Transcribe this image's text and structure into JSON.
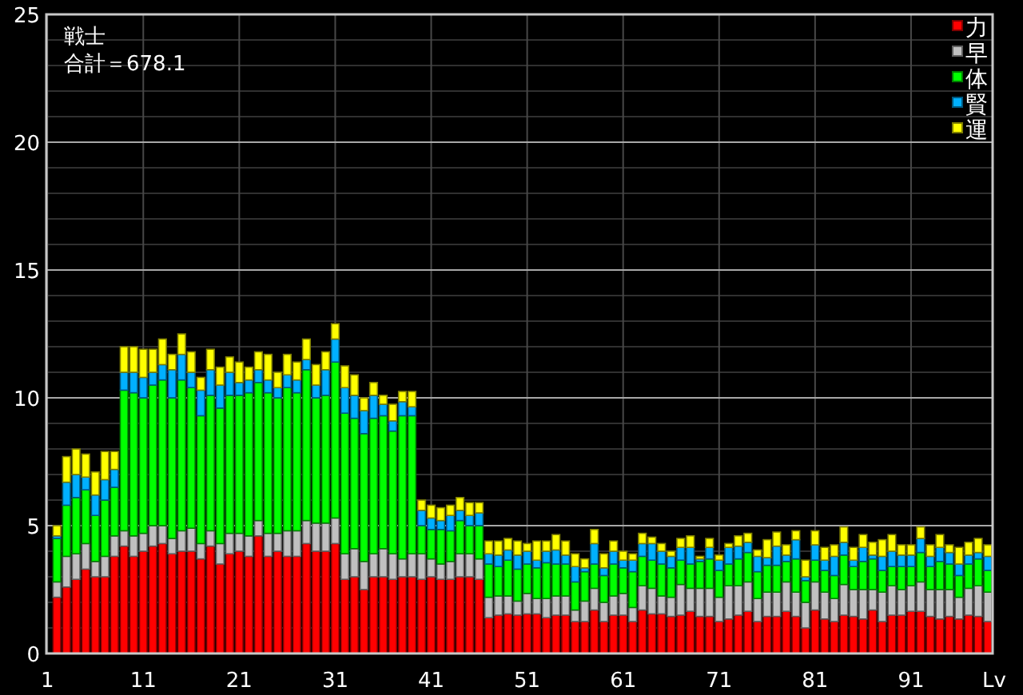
{
  "chart": {
    "total_label": "合計＝678.1",
    "chart_data": {
      "type": "bar",
      "stacked": true,
      "title": "戦士",
      "xlabel": "Lv",
      "x": [
        2,
        3,
        4,
        5,
        6,
        7,
        8,
        9,
        10,
        11,
        12,
        13,
        14,
        15,
        16,
        17,
        18,
        19,
        20,
        21,
        22,
        23,
        24,
        25,
        26,
        27,
        28,
        29,
        30,
        31,
        32,
        33,
        34,
        35,
        36,
        37,
        38,
        39,
        40,
        41,
        42,
        43,
        44,
        45,
        46,
        47,
        48,
        49,
        50,
        51,
        52,
        53,
        54,
        55,
        56,
        57,
        58,
        59,
        60,
        61,
        62,
        63,
        64,
        65,
        66,
        67,
        68,
        69,
        70,
        71,
        72,
        73,
        74,
        75,
        76,
        77,
        78,
        79,
        80,
        81,
        82,
        83,
        84,
        85,
        86,
        87,
        88,
        89,
        90,
        91,
        92,
        93,
        94,
        95,
        96,
        97,
        98,
        99
      ],
      "xlim": [
        0.9,
        99.5
      ],
      "ylim": [
        0,
        25
      ],
      "xticks": [
        1,
        11,
        21,
        31,
        41,
        51,
        61,
        71,
        81,
        91
      ],
      "yticks": [
        0,
        5,
        10,
        15,
        20,
        25
      ],
      "grid": true,
      "legend": true,
      "series": [
        {
          "name": "力",
          "color": "#ff0000",
          "values": [
            2.2,
            2.6,
            2.9,
            3.3,
            3.0,
            3.0,
            3.8,
            4.2,
            3.8,
            4.0,
            4.2,
            4.3,
            3.9,
            4.0,
            4.0,
            3.7,
            4.2,
            3.5,
            3.9,
            4.0,
            3.8,
            4.6,
            3.8,
            4.0,
            3.8,
            3.8,
            4.3,
            4.0,
            4.0,
            4.3,
            2.9,
            3.0,
            2.5,
            3.0,
            3.0,
            2.9,
            3.0,
            3.0,
            2.9,
            3.0,
            2.9,
            2.9,
            3.0,
            3.0,
            2.9,
            1.4,
            1.5,
            1.55,
            1.5,
            1.55,
            1.55,
            1.4,
            1.5,
            1.5,
            1.25,
            1.25,
            1.7,
            1.25,
            1.5,
            1.5,
            1.25,
            1.7,
            1.55,
            1.55,
            1.45,
            1.5,
            1.65,
            1.45,
            1.45,
            1.25,
            1.35,
            1.5,
            1.65,
            1.25,
            1.45,
            1.45,
            1.65,
            1.45,
            1.0,
            1.7,
            1.35,
            1.25,
            1.5,
            1.45,
            1.35,
            1.7,
            1.25,
            1.5,
            1.5,
            1.65,
            1.65,
            1.45,
            1.35,
            1.45,
            1.35,
            1.5,
            1.45,
            1.25
          ]
        },
        {
          "name": "早",
          "color": "#c0c0c0",
          "values": [
            0.6,
            1.2,
            1.0,
            1.0,
            0.6,
            0.8,
            0.8,
            0.6,
            0.8,
            0.7,
            0.8,
            0.7,
            0.6,
            0.8,
            0.9,
            0.6,
            0.6,
            0.8,
            0.8,
            0.7,
            0.8,
            0.6,
            0.9,
            0.7,
            1.0,
            1.0,
            0.9,
            1.1,
            1.1,
            1.0,
            1.0,
            1.1,
            1.1,
            0.9,
            1.1,
            1.0,
            0.7,
            0.9,
            1.0,
            0.7,
            0.6,
            0.7,
            0.9,
            0.9,
            0.8,
            0.8,
            0.75,
            0.7,
            0.55,
            0.8,
            0.6,
            0.75,
            0.75,
            0.75,
            0.45,
            0.8,
            0.85,
            0.75,
            0.75,
            0.85,
            0.55,
            0.95,
            1.0,
            0.7,
            0.75,
            1.2,
            0.9,
            1.1,
            1.1,
            0.95,
            1.3,
            1.15,
            1.15,
            0.9,
            0.95,
            0.95,
            1.15,
            0.95,
            1.0,
            1.1,
            1.05,
            0.9,
            1.2,
            1.05,
            1.15,
            0.8,
            1.15,
            1.15,
            1.0,
            1.0,
            1.15,
            1.05,
            1.15,
            1.05,
            0.85,
            1.05,
            1.2,
            1.15
          ]
        },
        {
          "name": "体",
          "color": "#00ff00",
          "values": [
            1.7,
            2.0,
            2.2,
            2.1,
            1.8,
            2.2,
            1.9,
            5.5,
            5.6,
            5.3,
            5.5,
            5.7,
            5.5,
            5.9,
            5.5,
            5.0,
            5.3,
            5.3,
            5.4,
            5.4,
            5.6,
            5.4,
            5.5,
            5.3,
            5.6,
            5.4,
            5.9,
            4.9,
            5.0,
            6.1,
            5.5,
            5.1,
            5.0,
            5.3,
            5.2,
            4.8,
            5.6,
            5.4,
            1.1,
            1.15,
            1.35,
            1.2,
            1.3,
            1.1,
            1.3,
            1.3,
            1.15,
            1.4,
            1.25,
            1.15,
            1.2,
            1.4,
            1.25,
            1.25,
            1.1,
            1.15,
            0.95,
            1.05,
            1.25,
            1.0,
            1.4,
            1.15,
            1.1,
            1.25,
            1.15,
            0.95,
            0.95,
            1.05,
            1.15,
            1.05,
            0.85,
            1.05,
            1.15,
            1.05,
            1.05,
            1.05,
            0.8,
            1.3,
            0.85,
            0.85,
            0.85,
            0.9,
            1.15,
            0.9,
            1.1,
            1.2,
            0.85,
            0.75,
            0.9,
            0.75,
            1.15,
            0.9,
            1.1,
            1.0,
            0.85,
            0.95,
            1.05,
            0.85
          ]
        },
        {
          "name": "賢",
          "color": "#00b0ff",
          "values": [
            0.1,
            0.9,
            0.9,
            0.5,
            0.8,
            0.8,
            0.7,
            0.7,
            0.8,
            0.8,
            0.5,
            0.6,
            1.1,
            1.0,
            0.6,
            1.0,
            1.0,
            0.9,
            0.9,
            0.5,
            0.5,
            0.5,
            0.5,
            0.4,
            0.5,
            0.5,
            0.4,
            0.5,
            1.0,
            0.9,
            1.0,
            0.9,
            0.9,
            0.9,
            0.45,
            0.4,
            0.55,
            0.35,
            0.6,
            0.45,
            0.35,
            0.6,
            0.4,
            0.4,
            0.5,
            0.4,
            0.45,
            0.4,
            0.55,
            0.5,
            0.3,
            0.45,
            0.55,
            0.35,
            0.6,
            0.15,
            0.8,
            0.3,
            0.5,
            0.3,
            0.45,
            0.5,
            0.65,
            0.5,
            0.45,
            0.5,
            0.65,
            0.1,
            0.45,
            0.4,
            0.65,
            0.5,
            0.4,
            0.6,
            0.3,
            0.75,
            0.25,
            0.75,
            0.15,
            0.6,
            0.4,
            0.75,
            0.5,
            0.25,
            0.55,
            0.15,
            0.55,
            0.6,
            0.45,
            0.45,
            0.55,
            0.4,
            0.55,
            0.45,
            0.45,
            0.35,
            0.25,
            0.55
          ]
        },
        {
          "name": "運",
          "color": "#ffff00",
          "values": [
            0.4,
            1.0,
            1.0,
            0.9,
            0.9,
            1.1,
            0.7,
            1.0,
            1.0,
            1.1,
            0.9,
            1.0,
            0.6,
            0.8,
            0.8,
            0.5,
            0.8,
            0.7,
            0.6,
            0.8,
            0.5,
            0.7,
            1.0,
            0.6,
            0.8,
            0.7,
            0.8,
            0.8,
            0.7,
            0.6,
            0.85,
            0.8,
            0.5,
            0.5,
            0.35,
            0.65,
            0.4,
            0.6,
            0.4,
            0.5,
            0.5,
            0.4,
            0.5,
            0.5,
            0.4,
            0.5,
            0.55,
            0.45,
            0.55,
            0.3,
            0.75,
            0.4,
            0.6,
            0.55,
            0.5,
            0.35,
            0.55,
            0.55,
            0.4,
            0.35,
            0.25,
            0.4,
            0.25,
            0.3,
            0.2,
            0.35,
            0.45,
            0.1,
            0.35,
            0.2,
            0.15,
            0.4,
            0.35,
            0.25,
            0.7,
            0.55,
            0.4,
            0.35,
            0.65,
            0.55,
            0.5,
            0.45,
            0.6,
            0.5,
            0.5,
            0.5,
            0.65,
            0.65,
            0.4,
            0.4,
            0.45,
            0.45,
            0.5,
            0.3,
            0.65,
            0.5,
            0.55,
            0.45
          ]
        }
      ]
    }
  }
}
